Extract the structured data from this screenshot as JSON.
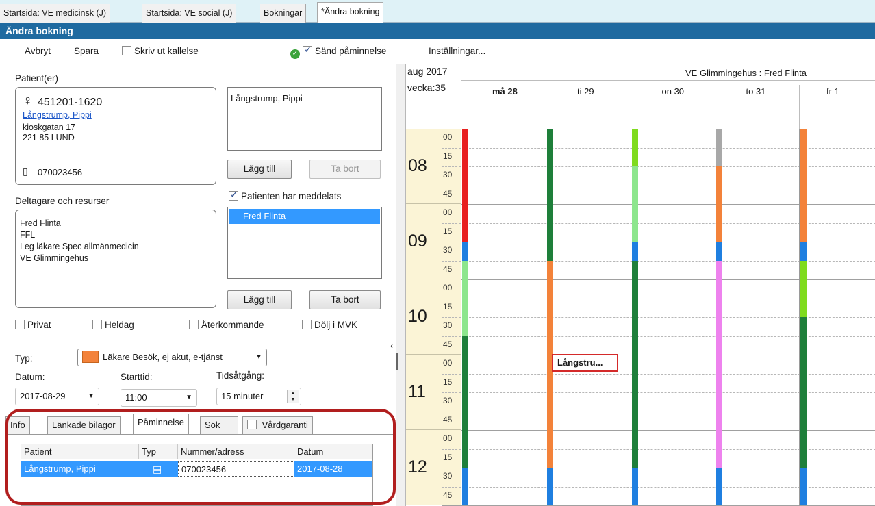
{
  "top_tabs": [
    "Startsida: VE medicinsk (J)",
    "Startsida: VE social (J)",
    "Bokningar",
    "*Ändra bokning"
  ],
  "window_title": "Ändra bokning",
  "toolbar": {
    "cancel": "Avbryt",
    "save": "Spara",
    "print_notice": "Skriv ut kallelse",
    "send_reminder": "Sänd påminnelse",
    "settings": "Inställningar..."
  },
  "patient": {
    "section_label": "Patient(er)",
    "personal_number": "451201-1620",
    "name": "Långstrump, Pippi",
    "address_line1": "kioskgatan 17",
    "address_line2": "221 85 LUND",
    "phone": "070023456",
    "list_item": "Långstrump, Pippi",
    "add_button": "Lägg till",
    "remove_button": "Ta bort",
    "informed_checkbox": "Patienten har meddelats"
  },
  "participants": {
    "section_label": "Deltagare och resurser",
    "lines": [
      "Fred Flinta",
      "FFL",
      "Leg läkare Spec allmänmedicin",
      "VE Glimmingehus"
    ],
    "selected_item": "Fred Flinta",
    "add_button": "Lägg till",
    "remove_button": "Ta bort"
  },
  "options": {
    "private": "Privat",
    "all_day": "Heldag",
    "recurring": "Återkommande",
    "hide_mvk": "Dölj i MVK"
  },
  "booking": {
    "type_label": "Typ:",
    "type_value": "Läkare Besök, ej akut, e-tjänst",
    "type_color": "#f3823a",
    "date_label": "Datum:",
    "date_value": "2017-08-29",
    "start_label": "Starttid:",
    "start_value": "11:00",
    "duration_label": "Tidsåtgång:",
    "duration_value": "15 minuter"
  },
  "bottom_tabs": [
    "Info",
    "Länkade bilagor",
    "Påminnelse",
    "Sök",
    "Vårdgaranti"
  ],
  "reminder_table": {
    "headers": [
      "Patient",
      "Typ",
      "Nummer/adress",
      "Datum"
    ],
    "rows": [
      {
        "patient": "Långstrump, Pippi",
        "type_icon": "phone-sms-icon",
        "number": "070023456",
        "date": "2017-08-28"
      }
    ]
  },
  "calendar": {
    "month": "aug 2017",
    "week": "vecka:35",
    "resource": "VE Glimmingehus : Fred Flinta",
    "days": [
      "må 28",
      "ti 29",
      "on 30",
      "to 31",
      "fr 1"
    ],
    "hours": [
      "08",
      "09",
      "10",
      "11",
      "12"
    ],
    "minutes": [
      "00",
      "15",
      "30",
      "45"
    ],
    "booking_label": "Långstru..."
  }
}
